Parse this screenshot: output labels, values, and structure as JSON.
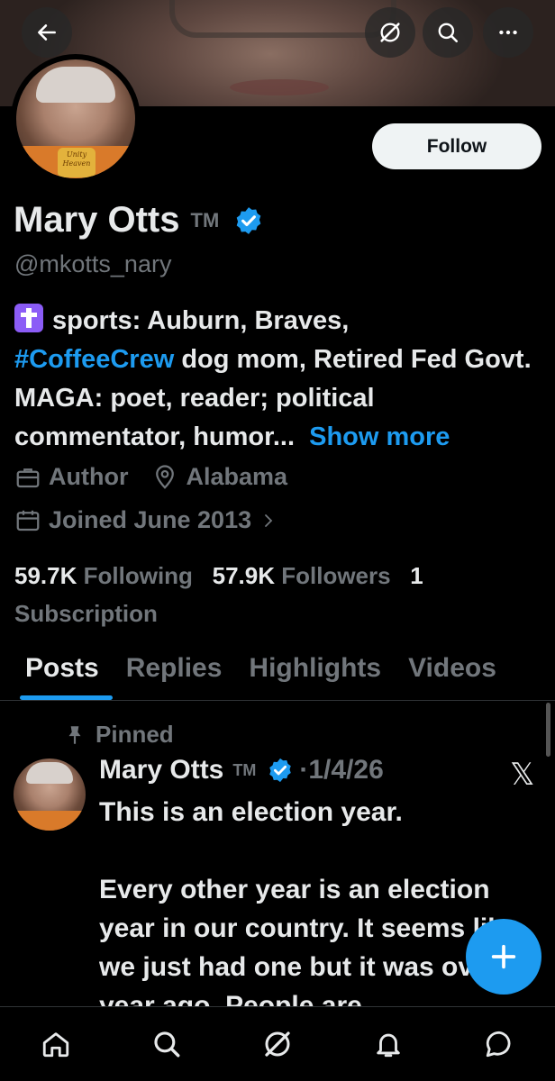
{
  "header": {
    "back_icon": "arrow-left-icon",
    "grok_icon": "grok-icon",
    "search_icon": "search-icon",
    "more_icon": "more-horizontal-icon"
  },
  "profile": {
    "follow_label": "Follow",
    "name": "Mary Otts",
    "tm": "TM",
    "verified_color": "#1d9bf0",
    "handle": "@mkotts_nary",
    "bio_part1": "sports: Auburn, Braves,",
    "bio_hashtag": "#CoffeeCrew",
    "bio_part2": " dog mom, Retired Fed Govt. MAGA: poet, reader; political commentator, humor...",
    "show_more": "Show more",
    "occupation": "Author",
    "location": "Alabama",
    "joined": "Joined June 2013",
    "following_count": "59.7K",
    "following_label": "Following",
    "followers_count": "57.9K",
    "followers_label": "Followers",
    "subscription_count": "1",
    "subscription_label": "Subscription",
    "avatar_badge": "Unity Heaven"
  },
  "tabs": [
    {
      "label": "Posts"
    },
    {
      "label": "Replies"
    },
    {
      "label": "Highlights"
    },
    {
      "label": "Videos"
    }
  ],
  "post": {
    "pinned_label": "Pinned",
    "name": "Mary Otts",
    "tm": "TM",
    "date": "·1/4/26",
    "body": "This is an election year.\n\nEvery other year is an election year in our country. It seems like we just had one but it was over a year ago. People are"
  },
  "colors": {
    "accent": "#1d9bf0",
    "muted": "#71767b",
    "background": "#000000"
  },
  "nav": [
    {
      "icon": "home-icon"
    },
    {
      "icon": "search-icon"
    },
    {
      "icon": "grok-icon"
    },
    {
      "icon": "bell-icon"
    },
    {
      "icon": "messages-icon"
    }
  ]
}
